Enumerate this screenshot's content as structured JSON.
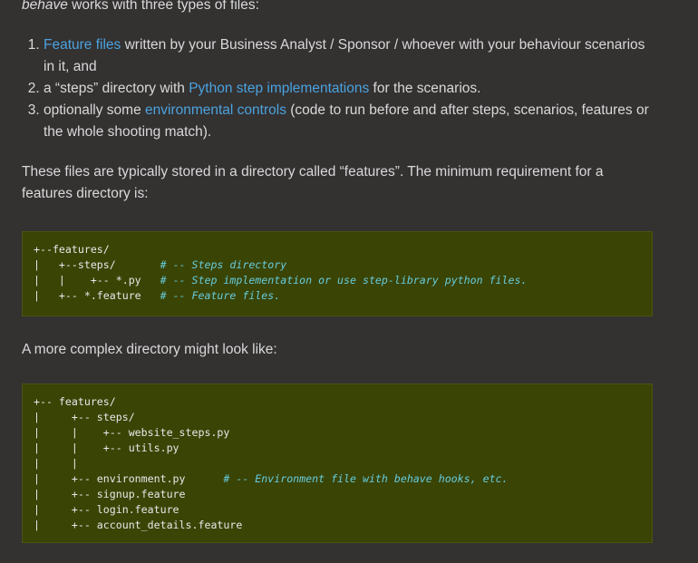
{
  "intro": {
    "em": "behave",
    "rest": " works with three types of files:"
  },
  "list": [
    {
      "link": "Feature files",
      "text": " written by your Business Analyst / Sponsor / whoever with your behaviour scenarios in it, and"
    },
    {
      "prefix": "a “steps” directory with ",
      "link": "Python step implementations",
      "suffix": " for the scenarios."
    },
    {
      "prefix": "optionally some ",
      "link": "environmental controls",
      "suffix": " (code to run before and after steps, scenarios, features or the whole shooting match)."
    }
  ],
  "para1": "These files are typically stored in a directory called “features”. The minimum requirement for a features directory is:",
  "code1": [
    {
      "code": "+--features/",
      "comment": ""
    },
    {
      "code": "|   +--steps/       ",
      "comment": "# -- Steps directory"
    },
    {
      "code": "|   |    +-- *.py   ",
      "comment": "# -- Step implementation or use step-library python files."
    },
    {
      "code": "|   +-- *.feature   ",
      "comment": "# -- Feature files."
    }
  ],
  "para2": "A more complex directory might look like:",
  "code2": [
    {
      "code": "+-- features/",
      "comment": ""
    },
    {
      "code": "|     +-- steps/",
      "comment": ""
    },
    {
      "code": "|     |    +-- website_steps.py",
      "comment": ""
    },
    {
      "code": "|     |    +-- utils.py",
      "comment": ""
    },
    {
      "code": "|     |",
      "comment": ""
    },
    {
      "code": "|     +-- environment.py      ",
      "comment": "# -- Environment file with behave hooks, etc."
    },
    {
      "code": "|     +-- signup.feature",
      "comment": ""
    },
    {
      "code": "|     +-- login.feature",
      "comment": ""
    },
    {
      "code": "|     +-- account_details.feature",
      "comment": ""
    }
  ]
}
